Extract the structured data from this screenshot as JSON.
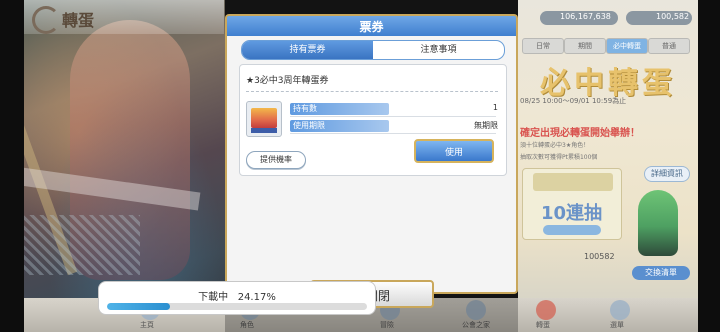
{
  "background": {
    "page_title": "轉蛋",
    "resources": [
      "106,167,638",
      "100,582"
    ],
    "tabs": [
      "日常",
      "期間",
      "必中轉蛋",
      "普通"
    ],
    "banner_title": "必中轉蛋",
    "banner_date": "08/25 10:00〜09/01 10:59為止",
    "banner_notice": "確定出現必轉蛋開始舉辦！",
    "banner_line1": "須十位轉蛋必中3★角色！",
    "banner_line2": "抽取次數可獲得Pt累積100個",
    "gacha_ten": "10連抽",
    "detail_button": "詳細資訊",
    "exchange_button": "交換清單",
    "bottom_count": "100582",
    "bottom_nav": [
      "主頁",
      "角色",
      "冒險",
      "公會之家",
      "轉蛋",
      "選單"
    ]
  },
  "modal": {
    "title": "票券",
    "tabs": [
      "持有票券",
      "注意事項"
    ],
    "ticket": {
      "name": "★3必中3周年轉蛋券",
      "icon": "gacha-ticket-icon",
      "rows": [
        {
          "label": "持有數",
          "value": "1"
        },
        {
          "label": "使用期限",
          "value": "無期限"
        }
      ]
    },
    "odds_button": "提供機率",
    "use_button": "使用",
    "close_button": "關閉"
  },
  "download": {
    "label": "下載中",
    "percent_text": "24.17%",
    "progress": 0.2417
  },
  "colors": {
    "primary_blue": "#3f7fcf",
    "gold_border": "#c9a75b",
    "progress_fill": "#2b8fd0"
  }
}
